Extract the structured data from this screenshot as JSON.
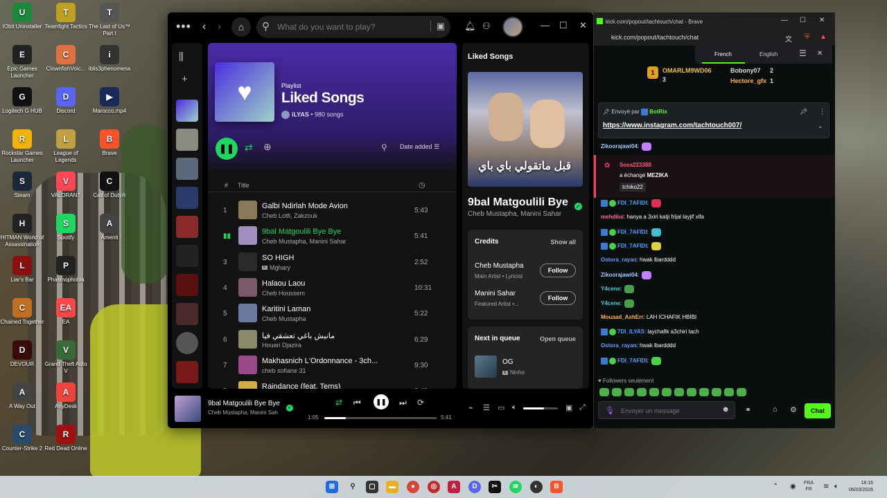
{
  "desktop": {
    "icons": [
      {
        "label": "IObit Uninstaller",
        "color": "#1a8a3a",
        "glyph": "U"
      },
      {
        "label": "Epic Games Launcher",
        "color": "#222222",
        "glyph": "E"
      },
      {
        "label": "Logitech G HUB",
        "color": "#111111",
        "glyph": "G"
      },
      {
        "label": "Rockstar Games Launcher",
        "color": "#f2b400",
        "glyph": "R"
      },
      {
        "label": "Steam",
        "color": "#1b2838",
        "glyph": "S"
      },
      {
        "label": "HITMAN World of Assassination",
        "color": "#222222",
        "glyph": "H"
      },
      {
        "label": "Liar's Bar",
        "color": "#8a1010",
        "glyph": "L"
      },
      {
        "label": "Chained Together",
        "color": "#c07020",
        "glyph": "C"
      },
      {
        "label": "DEVOUR",
        "color": "#3a0a0a",
        "glyph": "D"
      },
      {
        "label": "A Way Out",
        "color": "#444444",
        "glyph": "A"
      },
      {
        "label": "Counter-Strike 2",
        "color": "#2a4a6a",
        "glyph": "C"
      },
      {
        "label": "Teamfight Tactics",
        "color": "#c0a020",
        "glyph": "T"
      },
      {
        "label": "ClownfishVoic...",
        "color": "#e07040",
        "glyph": "C"
      },
      {
        "label": "Discord",
        "color": "#5865f2",
        "glyph": "D"
      },
      {
        "label": "League of Legends",
        "color": "#c0a040",
        "glyph": "L"
      },
      {
        "label": "VALORANT",
        "color": "#ff4655",
        "glyph": "V"
      },
      {
        "label": "Spotify",
        "color": "#1ed760",
        "glyph": "S"
      },
      {
        "label": "Phasmophobia",
        "color": "#222222",
        "glyph": "P"
      },
      {
        "label": "EA",
        "color": "#ff4747",
        "glyph": "EA"
      },
      {
        "label": "Grand Theft Auto V",
        "color": "#3a6a3a",
        "glyph": "V"
      },
      {
        "label": "AnyDesk",
        "color": "#ef443b",
        "glyph": "A"
      },
      {
        "label": "Red Dead Online",
        "color": "#a01010",
        "glyph": "R"
      },
      {
        "label": "The Last of Us™ Part I",
        "color": "#555555",
        "glyph": "T"
      },
      {
        "label": "iblis3phenomena",
        "color": "#333333",
        "glyph": "i"
      },
      {
        "label": "Marocco.mp4",
        "color": "#1a2a5a",
        "glyph": "▶"
      },
      {
        "label": "Brave",
        "color": "#fb542b",
        "glyph": "B"
      },
      {
        "label": "Call of Duty®",
        "color": "#111111",
        "glyph": "C"
      },
      {
        "label": "Amenti",
        "color": "#444444",
        "glyph": "A"
      }
    ]
  },
  "spotify": {
    "search_placeholder": "What do you want to play?",
    "playlist": {
      "type": "Playlist",
      "title": "Liked Songs",
      "owner": "iLYAS",
      "count": "980 songs"
    },
    "sort_label": "Date added",
    "columns": {
      "num": "#",
      "title": "Title"
    },
    "tracks": [
      {
        "num": "1",
        "title": "Galbi Ndirlah Mode Avion",
        "artist": "Cheb Lotfi, Zakzouk",
        "duration": "5:43",
        "explicit": false,
        "video": false,
        "active": false,
        "color": "#8a7a5a"
      },
      {
        "num": "",
        "title": "9bal Matgoulili Bye Bye",
        "artist": "Cheb Mustapha, Manini Sahar",
        "duration": "5:41",
        "explicit": false,
        "video": false,
        "active": true,
        "color": "#a090c0"
      },
      {
        "num": "3",
        "title": "SO HIGH",
        "artist": "Mghary",
        "duration": "2:52",
        "explicit": true,
        "video": false,
        "active": false,
        "color": "#2a2a2a"
      },
      {
        "num": "4",
        "title": "Halaou Laou",
        "artist": "Cheb Houssem",
        "duration": "10:31",
        "explicit": false,
        "video": false,
        "active": false,
        "color": "#7a5a6a"
      },
      {
        "num": "5",
        "title": "Karitini Laman",
        "artist": "Cheb Mustapha",
        "duration": "5:22",
        "explicit": false,
        "video": false,
        "active": false,
        "color": "#6a7aa0"
      },
      {
        "num": "6",
        "title": "مانيش باغي تعشقي فيا",
        "artist": "Houari Djazira",
        "duration": "6:29",
        "explicit": false,
        "video": false,
        "active": false,
        "color": "#8a8a6a"
      },
      {
        "num": "7",
        "title": "Makhasnich L'Ordonnance - 3ch...",
        "artist": "cheb sofiane 31",
        "duration": "9:30",
        "explicit": false,
        "video": false,
        "active": false,
        "color": "#9a4a8a"
      },
      {
        "num": "8",
        "title": "Raindance (feat. Tems)",
        "artist": "Music video • Dave, Tems",
        "duration": "3:40",
        "explicit": true,
        "video": true,
        "active": false,
        "color": "#d0b040"
      }
    ],
    "now_playing_panel": {
      "header": "Liked Songs",
      "cover_text": "قبل ماتقولي باي باي",
      "title": "9bal Matgoulili Bye B",
      "artist": "Cheb Mustapha, Manini Sahar",
      "credits_header": "Credits",
      "show_all": "Show all",
      "credits": [
        {
          "name": "Cheb Mustapha",
          "role": "Main Artist • Lyricist",
          "button": "Follow"
        },
        {
          "name": "Manini Sahar",
          "role": "Featured Artist •...",
          "button": "Follow"
        }
      ],
      "queue_header": "Next in queue",
      "open_queue": "Open queue",
      "queue_item": {
        "title": "OG",
        "artist": "Ninho"
      }
    },
    "player": {
      "title": "9bal Matgoulili Bye Bye",
      "artist": "Cheb Mustapha, Manini Sah",
      "elapsed": "1:05",
      "total": "5:41",
      "progress": 0.19,
      "volume": 0.6
    }
  },
  "brave": {
    "window_title": "kick.com/popout/tachtouch/chat - Brave",
    "url": "kick.com/popout/tachtouch/chat",
    "kick": {
      "lang_french": "French",
      "lang_english": "English",
      "podium": [
        {
          "name": "OMARLM9WD06",
          "count": "3"
        },
        {
          "name": "Bobony07",
          "count": "2"
        },
        {
          "name": "Hectore_gfx",
          "count": "1"
        }
      ],
      "pinned": {
        "sent_by": "Envoyé par",
        "bot": "BotRix",
        "link": "https://www.instagram.com/tachtouch007/"
      },
      "gift": {
        "user": "Sosa223388",
        "text_prefix": "a échangé",
        "item": "MEZIKA",
        "tag": "tchiko22"
      },
      "messages": [
        {
          "user": "Zikoorajawi04",
          "text": "",
          "color": "#a0d0ff",
          "badge": false,
          "emote": "#c080ff"
        },
        {
          "user": "FDI_7AFIDI",
          "text": "",
          "color": "#4aa0ff",
          "badge": true,
          "emote": "#e03050"
        },
        {
          "user": "mehdiiui",
          "text": "hanya a 3xiri katji frijal layjif xifa",
          "color": "#ff6a9a",
          "badge": false,
          "emote": ""
        },
        {
          "user": "FDI_7AFIDI",
          "text": "",
          "color": "#4aa0ff",
          "badge": true,
          "emote": "#40c0d0"
        },
        {
          "user": "FDI_7AFIDI",
          "text": "",
          "color": "#4aa0ff",
          "badge": true,
          "emote": "#e0d040"
        },
        {
          "user": "Ostora_rayan",
          "text": "hwak lbardddd",
          "color": "#6a9aff",
          "badge": false,
          "emote": ""
        },
        {
          "user": "Zikoorajawi04",
          "text": "",
          "color": "#a0d0ff",
          "badge": false,
          "emote": "#c080ff"
        },
        {
          "user": "Y4cene",
          "text": "",
          "color": "#40d0d0",
          "badge": false,
          "emote": "#4aa04a"
        },
        {
          "user": "Y4cene",
          "text": "",
          "color": "#40d0d0",
          "badge": false,
          "emote": "#4aa04a"
        },
        {
          "user": "Mouaad_AshErr",
          "text": "LAH ICHAFIK HBIBI",
          "color": "#ffb04a",
          "badge": false,
          "emote": ""
        },
        {
          "user": "7DI_ILYAS",
          "text": "laychafik a3chiri tach",
          "color": "#4aa0ff",
          "badge": true,
          "emote": ""
        },
        {
          "user": "Ostora_rayan",
          "text": "hwak lbardddd",
          "color": "#6a9aff",
          "badge": false,
          "emote": ""
        },
        {
          "user": "FDI_7AFIDI",
          "text": "",
          "color": "#4aa0ff",
          "badge": true,
          "emote": "#4ad04a"
        }
      ],
      "followers_only": "Followers seulement",
      "input_placeholder": "Envoyer un message",
      "chat_button": "Chat"
    }
  },
  "taskbar": {
    "lang_top": "FRA",
    "lang_bottom": "FR",
    "time": "18:16",
    "date": "06/03/2026"
  }
}
